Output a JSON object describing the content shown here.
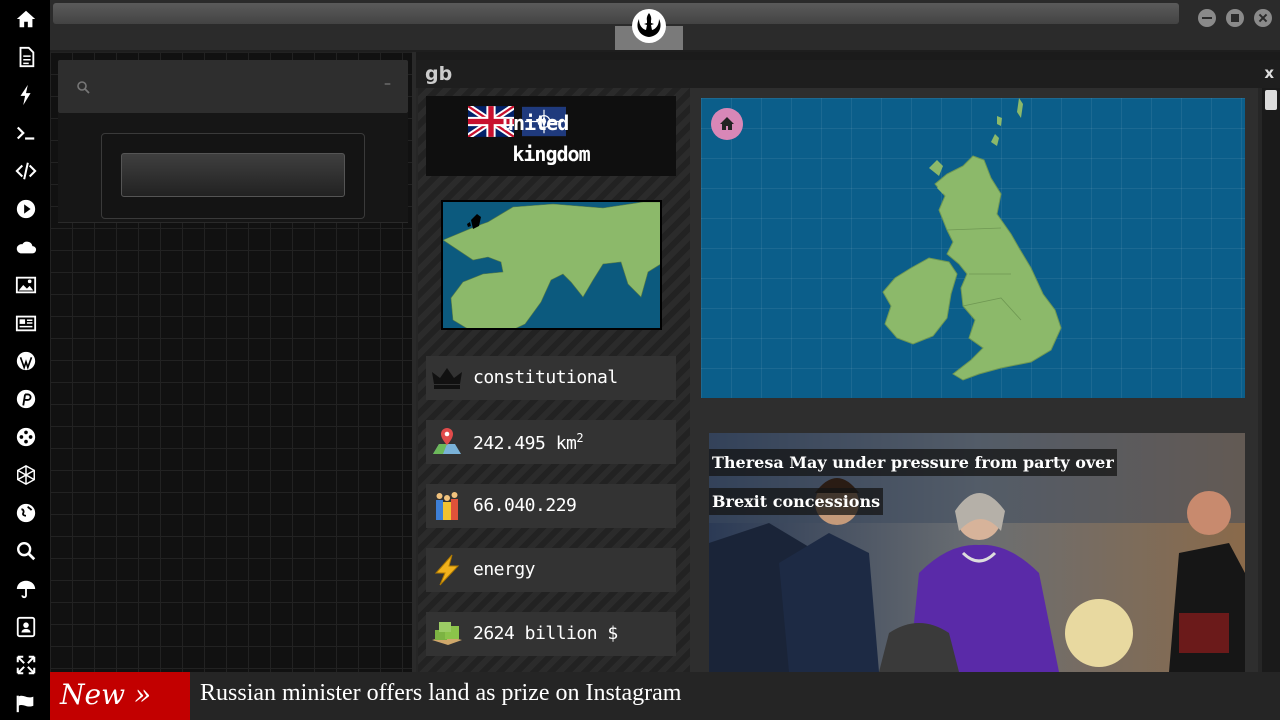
{
  "rail": {
    "icons": [
      "home-icon",
      "document-icon",
      "lightning-icon",
      "terminal-icon",
      "code-icon",
      "play-icon",
      "cloud-icon",
      "image-icon",
      "newspaper-icon",
      "wordpress-icon",
      "pinterest-icon",
      "film-reel-icon",
      "network-icon",
      "globe-icon",
      "search-icon",
      "umbrella-icon",
      "contact-card-icon",
      "expand-icon",
      "flag-icon"
    ]
  },
  "topbar": {
    "logo": "rebel-alliance-logo-icon",
    "window_controls": [
      "minimize-icon",
      "maximize-icon",
      "close-icon"
    ]
  },
  "left_panel": {
    "search": {
      "value": "",
      "placeholder": ""
    },
    "minimize_label": "–"
  },
  "country": {
    "code": "gb",
    "close_label": "x",
    "name_line1": "united",
    "name_line2": "kingdom",
    "flags": [
      "united-kingdom-flag-icon",
      "nato-flag-icon"
    ],
    "facts": [
      {
        "icon": "crown-icon",
        "text": "constitutional"
      },
      {
        "icon": "map-pin-icon",
        "text": "242.495 km",
        "sup": "2"
      },
      {
        "icon": "people-icon",
        "text": "66.040.229"
      },
      {
        "icon": "lightning-icon",
        "text": "energy"
      },
      {
        "icon": "money-icon",
        "text": "2624 billion $"
      }
    ]
  },
  "map": {
    "home_icon": "home-icon",
    "land_color": "#8cb96a",
    "sea_color": "#0b5e8a"
  },
  "news": {
    "headline": "Theresa May under pressure from party over Brexit concessions"
  },
  "ticker": {
    "badge": "New »",
    "text": "Russian minister offers land as prize on Instagram"
  },
  "colors": {
    "accent_red": "#c20000",
    "rail_bg": "#000000",
    "panel_bg": "#262626"
  }
}
